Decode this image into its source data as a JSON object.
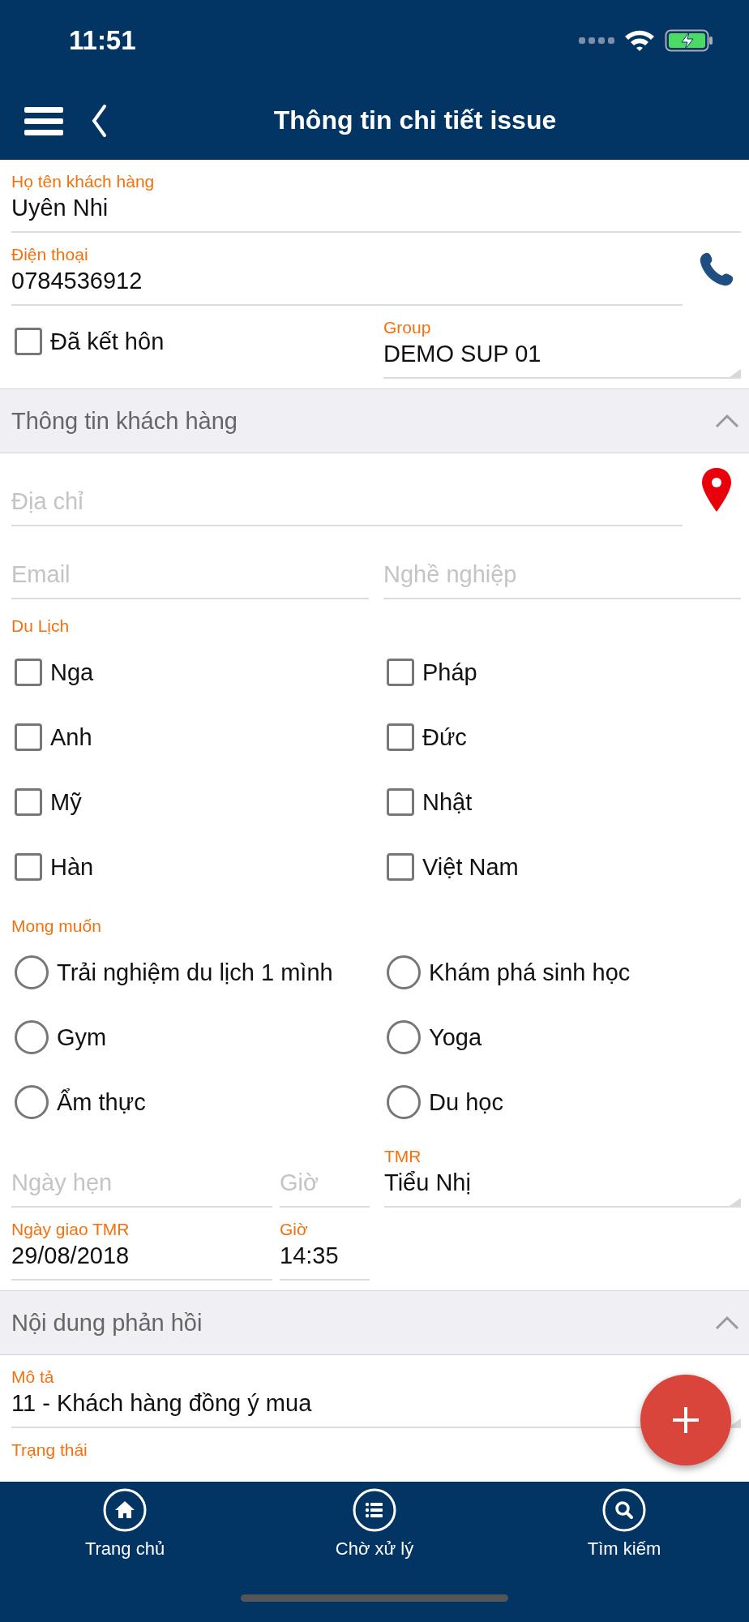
{
  "status_bar": {
    "time": "11:51"
  },
  "header": {
    "title": "Thông tin chi tiết issue"
  },
  "form": [
    {
      "kind": "full",
      "cells": [
        {
          "kind": "field",
          "label": "Họ tên khách hàng",
          "value": "Uyên Nhi"
        }
      ]
    },
    {
      "kind": "phone",
      "cells": [
        {
          "kind": "field",
          "label": "Điện thoại",
          "value": "0784536912"
        }
      ]
    },
    {
      "kind": "half",
      "cells": [
        {
          "kind": "checkbox",
          "label": "Đã kết hôn",
          "checked": false
        },
        {
          "kind": "dropdown",
          "label": "Group",
          "value": "DEMO SUP 01"
        }
      ]
    },
    {
      "kind": "section",
      "title": "Thông tin khách hàng",
      "expanded": true
    },
    {
      "kind": "address",
      "cells": [
        {
          "kind": "field",
          "placeholder": "Địa chỉ"
        }
      ]
    },
    {
      "kind": "half",
      "cells": [
        {
          "kind": "field",
          "placeholder": "Email"
        },
        {
          "kind": "field",
          "placeholder": "Nghề nghiệp"
        }
      ]
    },
    {
      "kind": "heading",
      "title": "Du Lịch"
    },
    {
      "kind": "options",
      "cells": [
        {
          "kind": "checkbox",
          "label": "Nga",
          "checked": false
        },
        {
          "kind": "checkbox",
          "label": "Pháp",
          "checked": false
        },
        {
          "kind": "checkbox",
          "label": "Anh",
          "checked": false
        },
        {
          "kind": "checkbox",
          "label": "Đức",
          "checked": false
        },
        {
          "kind": "checkbox",
          "label": "Mỹ",
          "checked": false
        },
        {
          "kind": "checkbox",
          "label": "Nhật",
          "checked": false
        },
        {
          "kind": "checkbox",
          "label": "Hàn",
          "checked": false
        },
        {
          "kind": "checkbox",
          "label": "Việt Nam",
          "checked": false
        }
      ]
    },
    {
      "kind": "heading",
      "title": "Mong muốn"
    },
    {
      "kind": "options",
      "cells": [
        {
          "kind": "radio",
          "label": "Trải nghiệm du lịch 1 mình",
          "selected": false
        },
        {
          "kind": "radio",
          "label": "Khám phá sinh học",
          "selected": false
        },
        {
          "kind": "radio",
          "label": "Gym",
          "selected": false
        },
        {
          "kind": "radio",
          "label": "Yoga",
          "selected": false
        },
        {
          "kind": "radio",
          "label": "Ẩm thực",
          "selected": false
        },
        {
          "kind": "radio",
          "label": "Du học",
          "selected": false
        }
      ]
    },
    {
      "kind": "date",
      "cells": [
        {
          "kind": "field",
          "placeholder": "Ngày hẹn"
        },
        {
          "kind": "field",
          "placeholder": "Giờ"
        },
        {
          "kind": "dropdown",
          "label": "TMR",
          "value": "Tiểu Nhị"
        }
      ]
    },
    {
      "kind": "date",
      "cells": [
        {
          "kind": "field",
          "label": "Ngày giao TMR",
          "value": "29/08/2018"
        },
        {
          "kind": "field",
          "label": "Giờ",
          "value": "14:35"
        }
      ]
    },
    {
      "kind": "section",
      "title": "Nội dung phản hồi",
      "expanded": true
    },
    {
      "kind": "full",
      "cells": [
        {
          "kind": "dropdown",
          "label": "Mô tả",
          "value": "11 - Khách hàng đồng ý mua"
        }
      ]
    },
    {
      "kind": "full",
      "cells": [
        {
          "kind": "dropdown",
          "label": "Trạng thái"
        }
      ]
    }
  ],
  "tabs": [
    {
      "label": "Trang chủ",
      "selected": false
    },
    {
      "label": "Chờ xử lý",
      "selected": false
    },
    {
      "label": "Tìm kiếm",
      "selected": false
    }
  ]
}
